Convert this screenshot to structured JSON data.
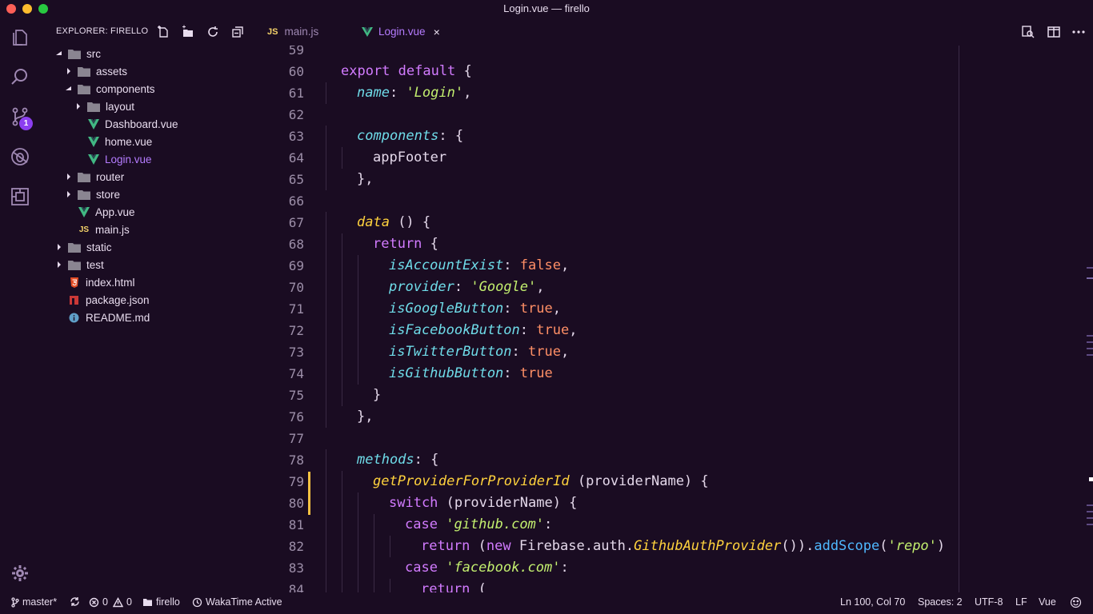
{
  "window": {
    "title": "Login.vue — firello"
  },
  "activity_bar": {
    "scm_badge": "1"
  },
  "sidebar": {
    "title": "EXPLORER: FIRELLO",
    "tree": [
      {
        "label": "src",
        "type": "folder",
        "expanded": true,
        "depth": 0
      },
      {
        "label": "assets",
        "type": "folder",
        "expanded": false,
        "depth": 1
      },
      {
        "label": "components",
        "type": "folder",
        "expanded": true,
        "depth": 1
      },
      {
        "label": "layout",
        "type": "folder",
        "expanded": false,
        "depth": 2
      },
      {
        "label": "Dashboard.vue",
        "type": "vue",
        "depth": 2
      },
      {
        "label": "home.vue",
        "type": "vue",
        "depth": 2
      },
      {
        "label": "Login.vue",
        "type": "vue",
        "depth": 2,
        "active": true
      },
      {
        "label": "router",
        "type": "folder",
        "expanded": false,
        "depth": 1
      },
      {
        "label": "store",
        "type": "folder",
        "expanded": false,
        "depth": 1
      },
      {
        "label": "App.vue",
        "type": "vue",
        "depth": 1
      },
      {
        "label": "main.js",
        "type": "js",
        "depth": 1
      },
      {
        "label": "static",
        "type": "folder",
        "expanded": false,
        "depth": 0
      },
      {
        "label": "test",
        "type": "folder",
        "expanded": false,
        "depth": 0
      },
      {
        "label": "index.html",
        "type": "html",
        "depth": 0
      },
      {
        "label": "package.json",
        "type": "npm",
        "depth": 0
      },
      {
        "label": "README.md",
        "type": "info",
        "depth": 0
      }
    ]
  },
  "tabs": [
    {
      "label": "main.js",
      "icon": "JS",
      "active": false
    },
    {
      "label": "Login.vue",
      "icon": "vue-icon",
      "active": true,
      "close": "×"
    }
  ],
  "editor": {
    "lines": [
      {
        "n": "59",
        "indent": 0,
        "tokens": []
      },
      {
        "n": "60",
        "indent": 0,
        "tokens": [
          {
            "t": "export default",
            "c": "kw"
          },
          {
            "t": " {",
            "c": "plain"
          }
        ]
      },
      {
        "n": "61",
        "indent": 1,
        "tokens": [
          {
            "t": "name",
            "c": "prop"
          },
          {
            "t": ": ",
            "c": "plain"
          },
          {
            "t": "'Login'",
            "c": "str"
          },
          {
            "t": ",",
            "c": "plain"
          }
        ]
      },
      {
        "n": "62",
        "indent": 0,
        "tokens": []
      },
      {
        "n": "63",
        "indent": 1,
        "tokens": [
          {
            "t": "components",
            "c": "prop"
          },
          {
            "t": ": {",
            "c": "plain"
          }
        ]
      },
      {
        "n": "64",
        "indent": 2,
        "tokens": [
          {
            "t": "appFooter",
            "c": "plain"
          }
        ]
      },
      {
        "n": "65",
        "indent": 1,
        "tokens": [
          {
            "t": "},",
            "c": "plain"
          }
        ]
      },
      {
        "n": "66",
        "indent": 0,
        "tokens": []
      },
      {
        "n": "67",
        "indent": 1,
        "tokens": [
          {
            "t": "data",
            "c": "fn"
          },
          {
            "t": " () {",
            "c": "plain"
          }
        ]
      },
      {
        "n": "68",
        "indent": 2,
        "tokens": [
          {
            "t": "return",
            "c": "kw"
          },
          {
            "t": " {",
            "c": "plain"
          }
        ]
      },
      {
        "n": "69",
        "indent": 3,
        "tokens": [
          {
            "t": "isAccountExist",
            "c": "prop"
          },
          {
            "t": ": ",
            "c": "plain"
          },
          {
            "t": "false",
            "c": "bool"
          },
          {
            "t": ",",
            "c": "plain"
          }
        ]
      },
      {
        "n": "70",
        "indent": 3,
        "tokens": [
          {
            "t": "provider",
            "c": "prop"
          },
          {
            "t": ": ",
            "c": "plain"
          },
          {
            "t": "'Google'",
            "c": "str"
          },
          {
            "t": ",",
            "c": "plain"
          }
        ]
      },
      {
        "n": "71",
        "indent": 3,
        "tokens": [
          {
            "t": "isGoogleButton",
            "c": "prop"
          },
          {
            "t": ": ",
            "c": "plain"
          },
          {
            "t": "true",
            "c": "bool"
          },
          {
            "t": ",",
            "c": "plain"
          }
        ]
      },
      {
        "n": "72",
        "indent": 3,
        "tokens": [
          {
            "t": "isFacebookButton",
            "c": "prop"
          },
          {
            "t": ": ",
            "c": "plain"
          },
          {
            "t": "true",
            "c": "bool"
          },
          {
            "t": ",",
            "c": "plain"
          }
        ]
      },
      {
        "n": "73",
        "indent": 3,
        "tokens": [
          {
            "t": "isTwitterButton",
            "c": "prop"
          },
          {
            "t": ": ",
            "c": "plain"
          },
          {
            "t": "true",
            "c": "bool"
          },
          {
            "t": ",",
            "c": "plain"
          }
        ]
      },
      {
        "n": "74",
        "indent": 3,
        "tokens": [
          {
            "t": "isGithubButton",
            "c": "prop"
          },
          {
            "t": ": ",
            "c": "plain"
          },
          {
            "t": "true",
            "c": "bool"
          }
        ]
      },
      {
        "n": "75",
        "indent": 2,
        "tokens": [
          {
            "t": "}",
            "c": "plain"
          }
        ]
      },
      {
        "n": "76",
        "indent": 1,
        "tokens": [
          {
            "t": "},",
            "c": "plain"
          }
        ]
      },
      {
        "n": "77",
        "indent": 0,
        "tokens": []
      },
      {
        "n": "78",
        "indent": 1,
        "tokens": [
          {
            "t": "methods",
            "c": "prop"
          },
          {
            "t": ": {",
            "c": "plain"
          }
        ]
      },
      {
        "n": "79",
        "indent": 2,
        "tokens": [
          {
            "t": "getProviderForProviderId",
            "c": "fn"
          },
          {
            "t": " (providerName) {",
            "c": "plain"
          }
        ]
      },
      {
        "n": "80",
        "indent": 3,
        "tokens": [
          {
            "t": "switch",
            "c": "kw"
          },
          {
            "t": " (providerName) {",
            "c": "plain"
          }
        ]
      },
      {
        "n": "81",
        "indent": 4,
        "tokens": [
          {
            "t": "case",
            "c": "kw"
          },
          {
            "t": " ",
            "c": "plain"
          },
          {
            "t": "'github.com'",
            "c": "str"
          },
          {
            "t": ":",
            "c": "plain"
          }
        ]
      },
      {
        "n": "82",
        "indent": 5,
        "tokens": [
          {
            "t": "return",
            "c": "kw"
          },
          {
            "t": " (",
            "c": "plain"
          },
          {
            "t": "new",
            "c": "kw"
          },
          {
            "t": " Firebase.auth.",
            "c": "plain"
          },
          {
            "t": "GithubAuthProvider",
            "c": "fn"
          },
          {
            "t": "()).",
            "c": "plain"
          },
          {
            "t": "addScope",
            "c": "meth"
          },
          {
            "t": "(",
            "c": "plain"
          },
          {
            "t": "'repo'",
            "c": "str"
          },
          {
            "t": ")",
            "c": "plain"
          }
        ]
      },
      {
        "n": "83",
        "indent": 4,
        "tokens": [
          {
            "t": "case",
            "c": "kw"
          },
          {
            "t": " ",
            "c": "plain"
          },
          {
            "t": "'facebook.com'",
            "c": "str"
          },
          {
            "t": ":",
            "c": "plain"
          }
        ]
      },
      {
        "n": "84",
        "indent": 5,
        "tokens": [
          {
            "t": "return",
            "c": "kw"
          },
          {
            "t": " (",
            "c": "plain"
          }
        ]
      }
    ]
  },
  "status_bar": {
    "branch": "master*",
    "errors": "0",
    "warnings": "0",
    "folder": "firello",
    "wakatime": "WakaTime Active",
    "position": "Ln 100, Col 70",
    "spaces": "Spaces: 2",
    "encoding": "UTF-8",
    "eol": "LF",
    "language": "Vue"
  },
  "colors": {
    "background": "#1a0c22",
    "keyword": "#d27bff",
    "property": "#6fdce9",
    "string": "#c3ef6f",
    "boolean": "#ff8f66",
    "function": "#ffd23d",
    "method": "#4fb8ff",
    "vue": "#41b883",
    "active_file": "#b57cff"
  }
}
